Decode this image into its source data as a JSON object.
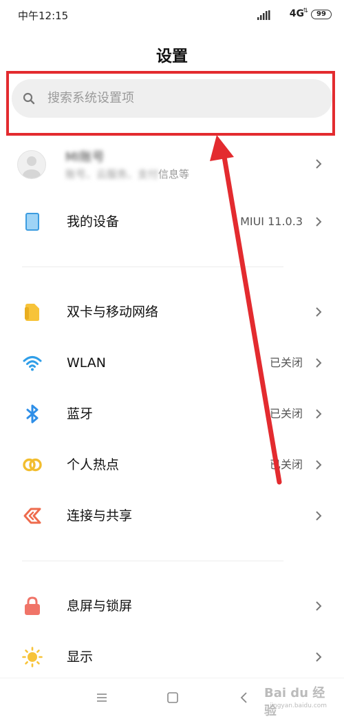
{
  "status": {
    "time": "中午12:15",
    "network": "4G",
    "battery": "99"
  },
  "title": "设置",
  "search": {
    "placeholder": "搜索系统设置项"
  },
  "profile": {
    "name": "MI账号",
    "subtitle_visible": "信息等",
    "subtitle_blurred": "账号、云服务、支付"
  },
  "rows": [
    {
      "label": "我的设备",
      "value": "MIUI 11.0.3",
      "icon": "device-icon",
      "color": "#4aa8e8"
    },
    {
      "label": "双卡与移动网络",
      "value": "",
      "icon": "sim-card-icon",
      "color": "#f7c339"
    },
    {
      "label": "WLAN",
      "value": "已关闭",
      "icon": "wifi-icon",
      "color": "#2f9ee8"
    },
    {
      "label": "蓝牙",
      "value": "已关闭",
      "icon": "bluetooth-icon",
      "color": "#2f8fe8"
    },
    {
      "label": "个人热点",
      "value": "已关闭",
      "icon": "hotspot-icon",
      "color": "#f2bd2e"
    },
    {
      "label": "连接与共享",
      "value": "",
      "icon": "connection-share-icon",
      "color": "#ee6b4d"
    },
    {
      "label": "息屏与锁屏",
      "value": "",
      "icon": "lock-icon",
      "color": "#f07468"
    },
    {
      "label": "显示",
      "value": "",
      "icon": "sun-icon",
      "color": "#f7c339"
    }
  ],
  "nav": {
    "items": [
      "menu-icon",
      "home-icon",
      "back-icon"
    ]
  },
  "watermark": {
    "text": "Bai du 经验",
    "sub": "jingyan.baidu.com"
  },
  "annotation": {
    "highlight_color": "#e32b2f"
  }
}
